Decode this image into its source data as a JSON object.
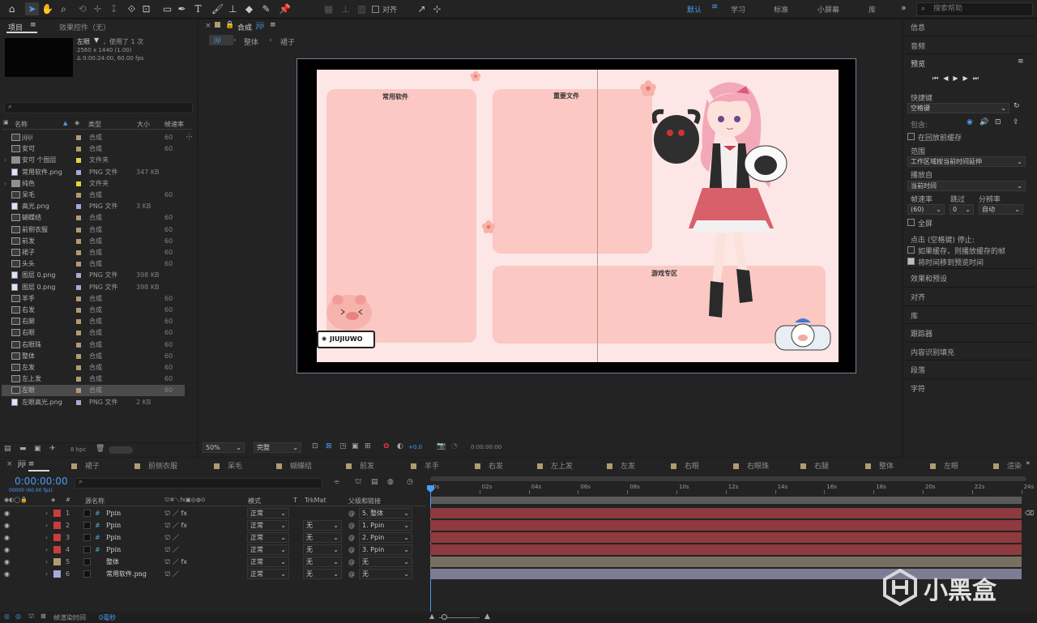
{
  "workspace": {
    "tabs": [
      "默认",
      "学习",
      "标准",
      "小屏幕",
      "库"
    ],
    "active_tab": "默认",
    "align_label": "对齐",
    "search_placeholder": "搜索帮助",
    "more_icon": "»"
  },
  "project_panel": {
    "tab_project": "项目",
    "tab_effects": "效果控件（无）",
    "selected_item": {
      "name": "左眼",
      "used": "，使用了 1 次",
      "dimensions": "2560 x 1440 (1.00)",
      "duration": "Δ 0:00:24:00, 60.00 fps"
    },
    "search_placeholder": "",
    "columns": [
      "名称",
      "类型",
      "大小",
      "帧速率"
    ],
    "items": [
      {
        "name": "jijiji",
        "type": "合成",
        "size": "",
        "fps": "60",
        "kind": "comp",
        "color": "#b29b71"
      },
      {
        "name": "安可",
        "type": "合成",
        "size": "",
        "fps": "60",
        "kind": "comp",
        "color": "#b29b71"
      },
      {
        "name": "安可 个图层",
        "type": "文件夹",
        "size": "",
        "fps": "",
        "kind": "folder",
        "color": "#e6d33c"
      },
      {
        "name": "常用软件.png",
        "type": "PNG 文件",
        "size": "347 KB",
        "fps": "",
        "kind": "file",
        "color": "#a7a7d8"
      },
      {
        "name": "纯色",
        "type": "文件夹",
        "size": "",
        "fps": "",
        "kind": "folder",
        "color": "#e6d33c"
      },
      {
        "name": "呆毛",
        "type": "合成",
        "size": "",
        "fps": "60",
        "kind": "comp",
        "color": "#b29b71"
      },
      {
        "name": "高光.png",
        "type": "PNG 文件",
        "size": "3 KB",
        "fps": "",
        "kind": "file",
        "color": "#a7a7d8"
      },
      {
        "name": "蝴蝶结",
        "type": "合成",
        "size": "",
        "fps": "60",
        "kind": "comp",
        "color": "#b29b71"
      },
      {
        "name": "前侧衣服",
        "type": "合成",
        "size": "",
        "fps": "60",
        "kind": "comp",
        "color": "#b29b71"
      },
      {
        "name": "前发",
        "type": "合成",
        "size": "",
        "fps": "60",
        "kind": "comp",
        "color": "#b29b71"
      },
      {
        "name": "裙子",
        "type": "合成",
        "size": "",
        "fps": "60",
        "kind": "comp",
        "color": "#b29b71"
      },
      {
        "name": "头头",
        "type": "合成",
        "size": "",
        "fps": "60",
        "kind": "comp",
        "color": "#b29b71"
      },
      {
        "name": "图层 0.png",
        "type": "PNG 文件",
        "size": "398 KB",
        "fps": "",
        "kind": "file",
        "color": "#a7a7d8"
      },
      {
        "name": "图层 0.png",
        "type": "PNG 文件",
        "size": "398 KB",
        "fps": "",
        "kind": "file",
        "color": "#a7a7d8"
      },
      {
        "name": "羊手",
        "type": "合成",
        "size": "",
        "fps": "60",
        "kind": "comp",
        "color": "#b29b71"
      },
      {
        "name": "右发",
        "type": "合成",
        "size": "",
        "fps": "60",
        "kind": "comp",
        "color": "#b29b71"
      },
      {
        "name": "右腿",
        "type": "合成",
        "size": "",
        "fps": "60",
        "kind": "comp",
        "color": "#b29b71"
      },
      {
        "name": "右眼",
        "type": "合成",
        "size": "",
        "fps": "60",
        "kind": "comp",
        "color": "#b29b71"
      },
      {
        "name": "右眼珠",
        "type": "合成",
        "size": "",
        "fps": "60",
        "kind": "comp",
        "color": "#b29b71"
      },
      {
        "name": "整体",
        "type": "合成",
        "size": "",
        "fps": "60",
        "kind": "comp",
        "color": "#b29b71"
      },
      {
        "name": "左发",
        "type": "合成",
        "size": "",
        "fps": "60",
        "kind": "comp",
        "color": "#b29b71"
      },
      {
        "name": "左上发",
        "type": "合成",
        "size": "",
        "fps": "60",
        "kind": "comp",
        "color": "#b29b71"
      },
      {
        "name": "左眼",
        "type": "合成",
        "size": "",
        "fps": "60",
        "kind": "comp",
        "color": "#b29b71",
        "selected": true
      },
      {
        "name": "左眼高光.png",
        "type": "PNG 文件",
        "size": "2 KB",
        "fps": "",
        "kind": "file",
        "color": "#a7a7d8"
      }
    ],
    "bpc": "8 bpc"
  },
  "composition": {
    "tab_label": "合成",
    "tab_name": "jiji",
    "breadcrumbs": [
      "jiji",
      "整体",
      "裙子"
    ],
    "card_titles": [
      "常用软件",
      "重要文件",
      "游戏专区"
    ],
    "logo_text": "JIUJIUWO",
    "zoom": "50%",
    "quality": "完整",
    "exposure": "+0.0",
    "timecode": "0:00:00:00"
  },
  "right_panel": {
    "info": "信息",
    "audio": "音频",
    "preview": "预览",
    "shortcut_label": "快捷键",
    "shortcut_value": "空格键",
    "include_label": "包含:",
    "cache_label": "在回放前缓存",
    "range_label": "范围",
    "range_value": "工作区域按当前时间延伸",
    "play_from_label": "播放自",
    "play_from_value": "当前时间",
    "fps_label": "帧速率",
    "skip_label": "跳过",
    "res_label": "分辨率",
    "fps_value": "(60)",
    "skip_value": "0",
    "res_value": "自动",
    "fullscreen_label": "全屏",
    "stop_label": "点击 (空格键) 停止:",
    "opt1": "如果缓存，则播放缓存的帧",
    "opt2": "将时间移到预览时间",
    "opt1_checked": false,
    "opt2_checked": true,
    "sections": [
      "效果和预设",
      "对齐",
      "库",
      "跟踪器",
      "内容识别填充",
      "段落",
      "字符"
    ]
  },
  "timeline": {
    "tabs": [
      "jiji",
      "裙子",
      "前侧衣服",
      "呆毛",
      "蝴蝶结",
      "前发",
      "羊手",
      "右发",
      "左上发",
      "左发",
      "右眼",
      "右眼珠",
      "右腿",
      "整体",
      "左眼",
      "渲染"
    ],
    "timecode": "0:00:00:00",
    "frame_info": "00000 (60.00 fps)",
    "columns": {
      "source": "源名称",
      "mode": "模式",
      "t": "T",
      "trkmat": "TrkMat",
      "parent": "父级和链接"
    },
    "ruler": [
      "0s",
      "02s",
      "04s",
      "06s",
      "08s",
      "10s",
      "12s",
      "14s",
      "16s",
      "18s",
      "20s",
      "22s",
      "24s"
    ],
    "layers": [
      {
        "num": "1",
        "name": "Ppin",
        "mode": "正常",
        "trkmat": "",
        "parent": "5. 整体",
        "label_color": "#cc3c3c",
        "bar_color": "#8e3a3f",
        "fx": true
      },
      {
        "num": "2",
        "name": "Ppin",
        "mode": "正常",
        "trkmat": "无",
        "parent": "1. Ppin",
        "label_color": "#cc3c3c",
        "bar_color": "#8e3a3f",
        "fx": true
      },
      {
        "num": "3",
        "name": "Ppin",
        "mode": "正常",
        "trkmat": "无",
        "parent": "2. Ppin",
        "label_color": "#cc3c3c",
        "bar_color": "#8e3a3f",
        "fx": false
      },
      {
        "num": "4",
        "name": "Ppin",
        "mode": "正常",
        "trkmat": "无",
        "parent": "3. Ppin",
        "label_color": "#cc3c3c",
        "bar_color": "#8e3a3f",
        "fx": false
      },
      {
        "num": "5",
        "name": "整体",
        "mode": "正常",
        "trkmat": "无",
        "parent": "无",
        "label_color": "#b29b71",
        "bar_color": "#777062",
        "fx": true
      },
      {
        "num": "6",
        "name": "常用软件.png",
        "mode": "正常",
        "trkmat": "无",
        "parent": "无",
        "label_color": "#a7a7d8",
        "bar_color": "#7d7c95",
        "fx": false
      }
    ],
    "render_time_label": "帧渲染时间",
    "render_time_value": "0毫秒"
  },
  "watermark": "小黑盒"
}
